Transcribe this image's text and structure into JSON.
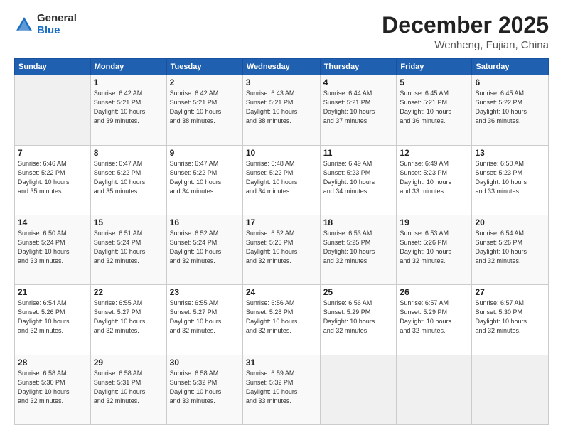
{
  "logo": {
    "general": "General",
    "blue": "Blue"
  },
  "title": {
    "month": "December 2025",
    "location": "Wenheng, Fujian, China"
  },
  "header_days": [
    "Sunday",
    "Monday",
    "Tuesday",
    "Wednesday",
    "Thursday",
    "Friday",
    "Saturday"
  ],
  "weeks": [
    [
      {
        "day": "",
        "info": ""
      },
      {
        "day": "1",
        "info": "Sunrise: 6:42 AM\nSunset: 5:21 PM\nDaylight: 10 hours\nand 39 minutes."
      },
      {
        "day": "2",
        "info": "Sunrise: 6:42 AM\nSunset: 5:21 PM\nDaylight: 10 hours\nand 38 minutes."
      },
      {
        "day": "3",
        "info": "Sunrise: 6:43 AM\nSunset: 5:21 PM\nDaylight: 10 hours\nand 38 minutes."
      },
      {
        "day": "4",
        "info": "Sunrise: 6:44 AM\nSunset: 5:21 PM\nDaylight: 10 hours\nand 37 minutes."
      },
      {
        "day": "5",
        "info": "Sunrise: 6:45 AM\nSunset: 5:21 PM\nDaylight: 10 hours\nand 36 minutes."
      },
      {
        "day": "6",
        "info": "Sunrise: 6:45 AM\nSunset: 5:22 PM\nDaylight: 10 hours\nand 36 minutes."
      }
    ],
    [
      {
        "day": "7",
        "info": "Sunrise: 6:46 AM\nSunset: 5:22 PM\nDaylight: 10 hours\nand 35 minutes."
      },
      {
        "day": "8",
        "info": "Sunrise: 6:47 AM\nSunset: 5:22 PM\nDaylight: 10 hours\nand 35 minutes."
      },
      {
        "day": "9",
        "info": "Sunrise: 6:47 AM\nSunset: 5:22 PM\nDaylight: 10 hours\nand 34 minutes."
      },
      {
        "day": "10",
        "info": "Sunrise: 6:48 AM\nSunset: 5:22 PM\nDaylight: 10 hours\nand 34 minutes."
      },
      {
        "day": "11",
        "info": "Sunrise: 6:49 AM\nSunset: 5:23 PM\nDaylight: 10 hours\nand 34 minutes."
      },
      {
        "day": "12",
        "info": "Sunrise: 6:49 AM\nSunset: 5:23 PM\nDaylight: 10 hours\nand 33 minutes."
      },
      {
        "day": "13",
        "info": "Sunrise: 6:50 AM\nSunset: 5:23 PM\nDaylight: 10 hours\nand 33 minutes."
      }
    ],
    [
      {
        "day": "14",
        "info": "Sunrise: 6:50 AM\nSunset: 5:24 PM\nDaylight: 10 hours\nand 33 minutes."
      },
      {
        "day": "15",
        "info": "Sunrise: 6:51 AM\nSunset: 5:24 PM\nDaylight: 10 hours\nand 32 minutes."
      },
      {
        "day": "16",
        "info": "Sunrise: 6:52 AM\nSunset: 5:24 PM\nDaylight: 10 hours\nand 32 minutes."
      },
      {
        "day": "17",
        "info": "Sunrise: 6:52 AM\nSunset: 5:25 PM\nDaylight: 10 hours\nand 32 minutes."
      },
      {
        "day": "18",
        "info": "Sunrise: 6:53 AM\nSunset: 5:25 PM\nDaylight: 10 hours\nand 32 minutes."
      },
      {
        "day": "19",
        "info": "Sunrise: 6:53 AM\nSunset: 5:26 PM\nDaylight: 10 hours\nand 32 minutes."
      },
      {
        "day": "20",
        "info": "Sunrise: 6:54 AM\nSunset: 5:26 PM\nDaylight: 10 hours\nand 32 minutes."
      }
    ],
    [
      {
        "day": "21",
        "info": "Sunrise: 6:54 AM\nSunset: 5:26 PM\nDaylight: 10 hours\nand 32 minutes."
      },
      {
        "day": "22",
        "info": "Sunrise: 6:55 AM\nSunset: 5:27 PM\nDaylight: 10 hours\nand 32 minutes."
      },
      {
        "day": "23",
        "info": "Sunrise: 6:55 AM\nSunset: 5:27 PM\nDaylight: 10 hours\nand 32 minutes."
      },
      {
        "day": "24",
        "info": "Sunrise: 6:56 AM\nSunset: 5:28 PM\nDaylight: 10 hours\nand 32 minutes."
      },
      {
        "day": "25",
        "info": "Sunrise: 6:56 AM\nSunset: 5:29 PM\nDaylight: 10 hours\nand 32 minutes."
      },
      {
        "day": "26",
        "info": "Sunrise: 6:57 AM\nSunset: 5:29 PM\nDaylight: 10 hours\nand 32 minutes."
      },
      {
        "day": "27",
        "info": "Sunrise: 6:57 AM\nSunset: 5:30 PM\nDaylight: 10 hours\nand 32 minutes."
      }
    ],
    [
      {
        "day": "28",
        "info": "Sunrise: 6:58 AM\nSunset: 5:30 PM\nDaylight: 10 hours\nand 32 minutes."
      },
      {
        "day": "29",
        "info": "Sunrise: 6:58 AM\nSunset: 5:31 PM\nDaylight: 10 hours\nand 32 minutes."
      },
      {
        "day": "30",
        "info": "Sunrise: 6:58 AM\nSunset: 5:32 PM\nDaylight: 10 hours\nand 33 minutes."
      },
      {
        "day": "31",
        "info": "Sunrise: 6:59 AM\nSunset: 5:32 PM\nDaylight: 10 hours\nand 33 minutes."
      },
      {
        "day": "",
        "info": ""
      },
      {
        "day": "",
        "info": ""
      },
      {
        "day": "",
        "info": ""
      }
    ]
  ]
}
